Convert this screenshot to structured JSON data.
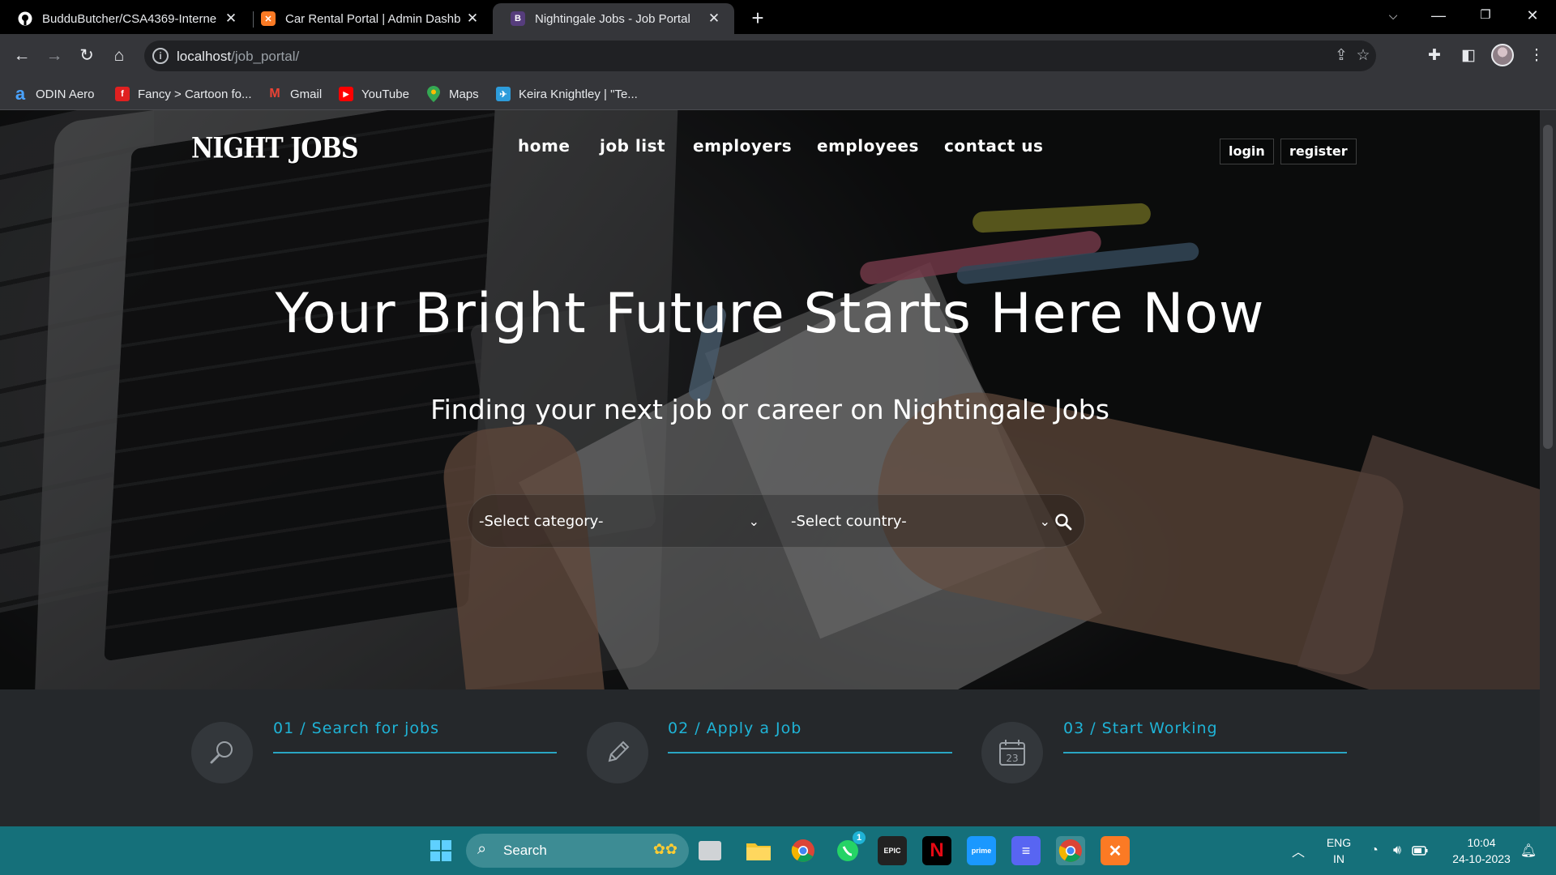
{
  "browser": {
    "tabs": [
      {
        "title": "BudduButcher/CSA4369-Interne",
        "icon": "github-icon",
        "active": false
      },
      {
        "title": "Car Rental Portal | Admin Dashb",
        "icon": "xampp-icon",
        "active": false
      },
      {
        "title": "Nightingale Jobs - Job Portal",
        "icon": "bootstrap-icon",
        "active": true
      }
    ],
    "url_host": "localhost",
    "url_path": "/job_portal/",
    "bookmarks": [
      {
        "label": "ODIN Aero",
        "icon": "odin-icon"
      },
      {
        "label": "Fancy > Cartoon fo...",
        "icon": "fancy-icon"
      },
      {
        "label": "Gmail",
        "icon": "gmail-icon"
      },
      {
        "label": "YouTube",
        "icon": "youtube-icon"
      },
      {
        "label": "Maps",
        "icon": "maps-icon"
      },
      {
        "label": "Keira Knightley | \"Te...",
        "icon": "bookmark-icon"
      }
    ]
  },
  "page": {
    "logo": "NIGHT JOBS",
    "nav": [
      "home",
      "job list",
      "employers",
      "employees",
      "contact us"
    ],
    "auth": {
      "login": "login",
      "register": "register"
    },
    "hero_title": "Your Bright Future Starts Here Now",
    "hero_subtitle": "Finding your next job or career on Nightingale Jobs",
    "search": {
      "category": "-Select category-",
      "country": "-Select country-"
    },
    "steps": [
      {
        "label": "01 / Search for jobs",
        "icon": "magnifier-icon"
      },
      {
        "label": "02 / Apply a Job",
        "icon": "pencil-icon"
      },
      {
        "label": "03 / Start Working",
        "icon": "calendar-icon",
        "calendar_day": "23"
      }
    ],
    "accent_color": "#1fb3d6"
  },
  "taskbar": {
    "search_placeholder": "Search",
    "whatsapp_badge": "1",
    "language": "ENG",
    "region": "IN",
    "time": "10:04",
    "date": "24-10-2023"
  }
}
